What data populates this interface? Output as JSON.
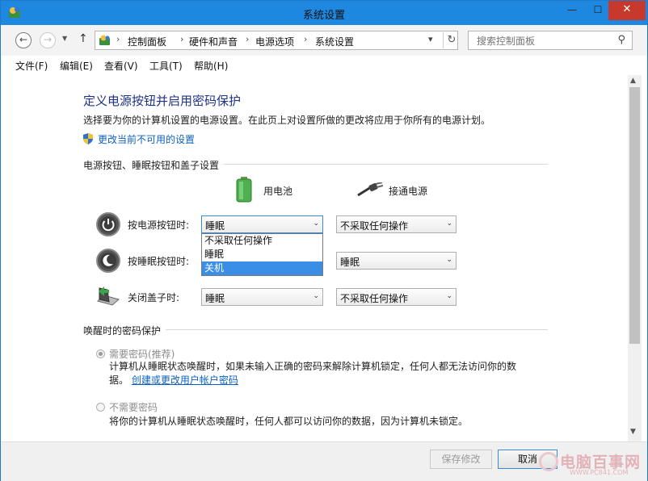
{
  "window": {
    "title": "系统设置",
    "min_glyph": "—",
    "max_glyph": "☐",
    "close_glyph": "✕"
  },
  "address": {
    "crumbs": [
      "控制面板",
      "硬件和声音",
      "电源选项",
      "系统设置"
    ],
    "search_placeholder": "搜索控制面板"
  },
  "menu": [
    "文件(F)",
    "编辑(E)",
    "查看(V)",
    "工具(T)",
    "帮助(H)"
  ],
  "page": {
    "heading": "定义电源按钮并启用密码保护",
    "description": "选择要为你的计算机设置的电源设置。在此页上对设置所做的更改将应用于你所有的电源计划。",
    "change_link": "更改当前不可用的设置",
    "group_power": "电源按钮、睡眠按钮和盖子设置",
    "col_battery": "用电池",
    "col_ac": "接通电源",
    "rows": [
      {
        "label": "按电源按钮时:",
        "battery": "睡眠",
        "ac": "不采取任何操作"
      },
      {
        "label": "按睡眠按钮时:",
        "battery": "睡眠",
        "ac": "睡眠"
      },
      {
        "label": "关闭盖子时:",
        "battery": "睡眠",
        "ac": "不采取任何操作"
      }
    ],
    "dropdown_options": [
      "不采取任何操作",
      "睡眠",
      "关机"
    ],
    "dropdown_highlighted": "关机",
    "group_wake": "唤醒时的密码保护",
    "opt_require": "需要密码(推荐)",
    "opt_require_text_1": "计算机从睡眠状态唤醒时，如果未输入正确的密码来解除计算机锁定，任何人都无法访问你的数",
    "opt_require_text_2_prefix": "据。",
    "opt_require_link": "创建或更改用户帐户密码",
    "opt_none": "不需要密码",
    "opt_none_text": "将你的计算机从睡眠状态唤醒时，任何人都可以访问你的数据，因为计算机未锁定。"
  },
  "footer": {
    "save": "保存修改",
    "cancel": "取消"
  },
  "watermark": {
    "text": "电脑百事网",
    "url": "WWW.PC841.COM"
  },
  "colors": {
    "title_bar": "#1e87e0",
    "close": "#c7392c",
    "heading": "#1e3287",
    "link": "#0b61c0",
    "highlight": "#3a8ee6"
  },
  "icons": [
    "control-panel-icon",
    "back-icon",
    "forward-icon",
    "up-icon",
    "refresh-icon",
    "search-icon",
    "shield-icon",
    "battery-icon",
    "plug-icon",
    "power-button-icon",
    "sleep-button-icon",
    "laptop-lid-icon"
  ]
}
